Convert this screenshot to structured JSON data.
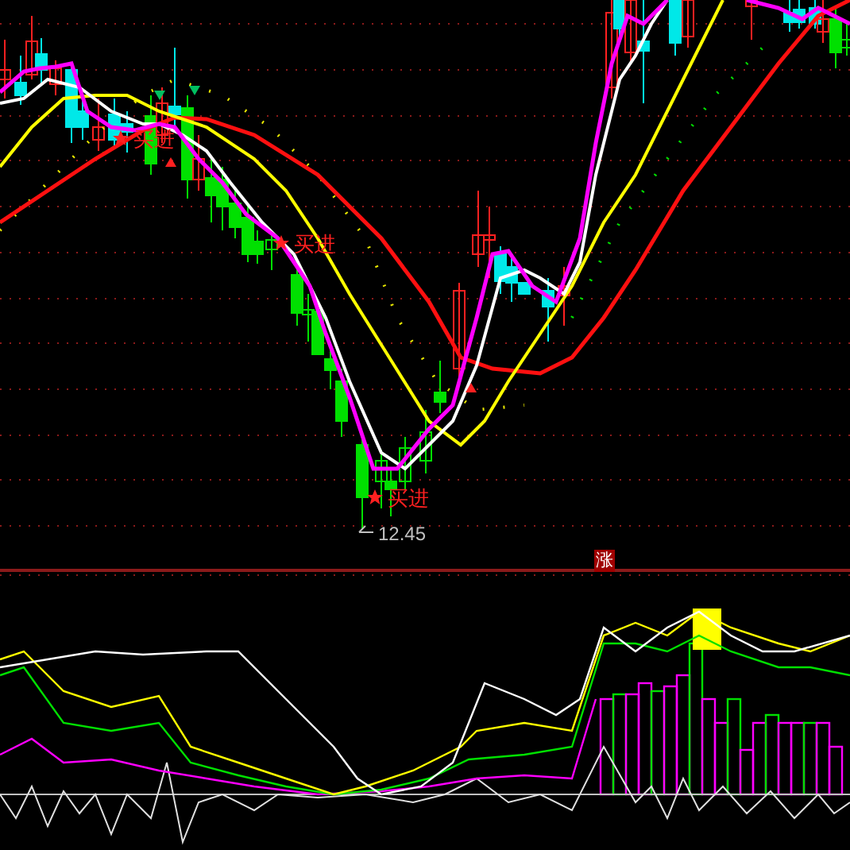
{
  "main_chart": {
    "signals": [
      {
        "label": "买进"
      },
      {
        "label": "买进"
      },
      {
        "label": "买进"
      }
    ],
    "low_marker": {
      "text": "12.45"
    }
  },
  "indicator_panel": {
    "badge": "涨"
  }
}
